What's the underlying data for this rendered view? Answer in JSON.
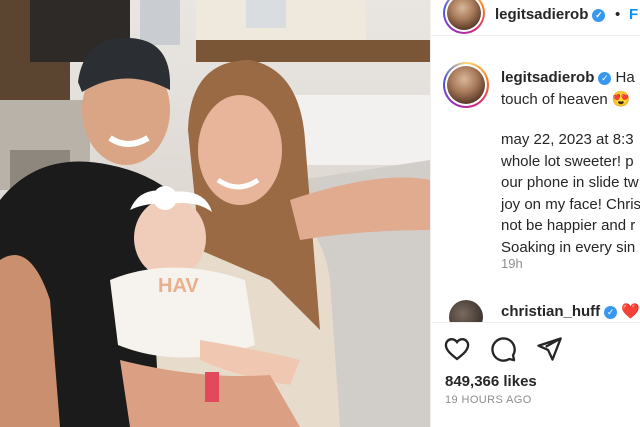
{
  "post": {
    "username": "legitsadierob",
    "header_dot": "•",
    "header_follow": "F",
    "caption_line1": "Ha",
    "caption_line2": "touch of heaven 😍",
    "caption_body": [
      "may 22, 2023 at 8:3",
      "whole lot sweeter! p",
      "our phone in slide tw",
      "joy on my face! Chris",
      "not be happier and r",
      "Soaking in every sin"
    ],
    "time_ago_short": "19h",
    "comment_username": "christian_huff",
    "comment_heart": "❤️",
    "likes": "849,366 likes",
    "posted_ago": "19 HOURS AGO"
  },
  "photo": {
    "onesie_text": "HAV"
  },
  "icons": {
    "like": "heart-outline-icon",
    "comment": "comment-bubble-icon",
    "share": "paper-plane-icon",
    "verified": "verified-check-icon"
  },
  "colors": {
    "link_blue": "#0095f6",
    "verified_blue": "#3897f0",
    "muted_gray": "#8e8e8e",
    "heart_red": "#ed4956"
  }
}
